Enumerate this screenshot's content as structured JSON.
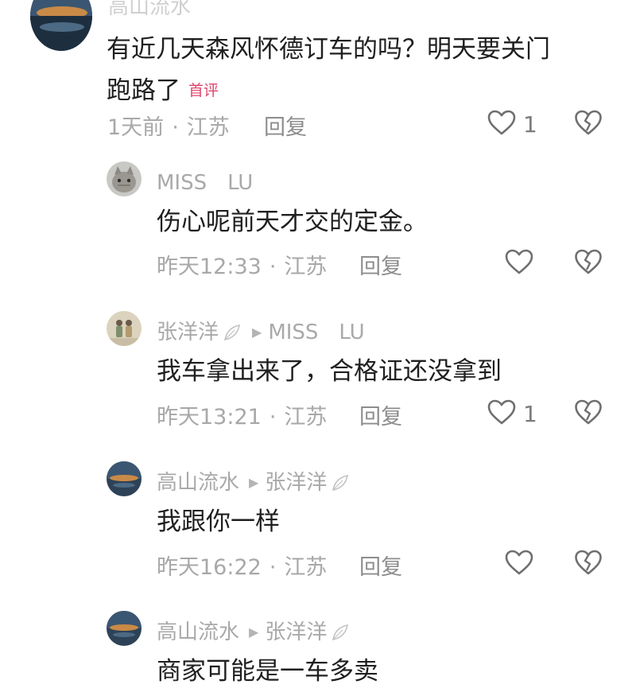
{
  "comments": [
    {
      "name": "高山流水",
      "text_lines": [
        "有近几天森风怀德订车的吗？明天要关门",
        "跑路了"
      ],
      "badge": "首评",
      "time": "1天前",
      "location": "江苏",
      "reply": "回复",
      "likes": "1"
    },
    {
      "name": "MISS　LU",
      "text": "伤心呢前天才交的定金。",
      "time": "昨天12:33",
      "location": "江苏",
      "reply": "回复",
      "likes": ""
    },
    {
      "name": "张洋洋",
      "reply_to": "MISS　LU",
      "text": "我车拿出来了，合格证还没拿到",
      "time": "昨天13:21",
      "location": "江苏",
      "reply": "回复",
      "likes": "1"
    },
    {
      "name": "高山流水",
      "reply_to": "张洋洋",
      "text": "我跟你一样",
      "time": "昨天16:22",
      "location": "江苏",
      "reply": "回复",
      "likes": ""
    },
    {
      "name": "高山流水",
      "reply_to": "张洋洋",
      "text": "商家可能是一车多卖"
    }
  ],
  "icons": {
    "like": "heart-outline-icon",
    "dislike": "broken-heart-icon",
    "reply_arrow": "triangle-right-icon"
  }
}
